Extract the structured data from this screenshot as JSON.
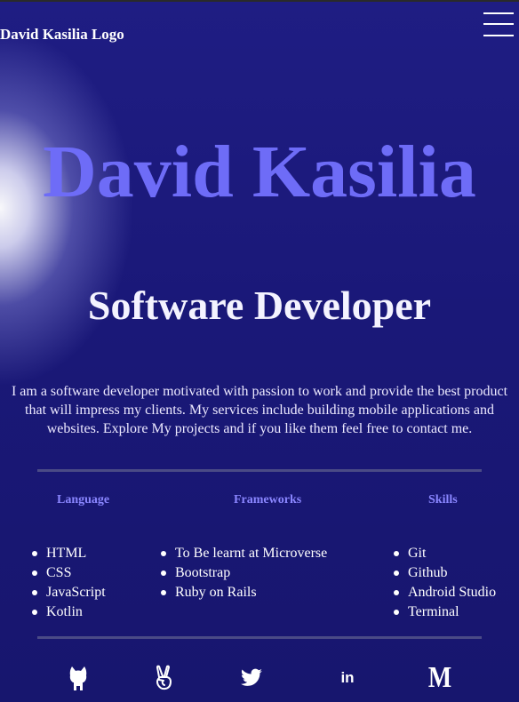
{
  "header": {
    "logo_text": "David Kasilia Logo",
    "menu_icon": "hamburger-menu-icon"
  },
  "hero": {
    "name": "David Kasilia",
    "role": "Software Developer",
    "intro": "I am a software developer motivated with passion to work and provide the best product that will impress my clients. My services include building mobile applications and websites. Explore My projects and if you like them feel free to contact me."
  },
  "columns": [
    {
      "heading": "Language",
      "items": [
        "HTML",
        "CSS",
        "JavaScript",
        "Kotlin"
      ]
    },
    {
      "heading": "Frameworks",
      "items": [
        "To Be learnt at Microverse",
        "Bootstrap",
        "Ruby on Rails"
      ]
    },
    {
      "heading": "Skills",
      "items": [
        "Git",
        "Github",
        "Android Studio",
        "Terminal"
      ]
    }
  ],
  "social": {
    "icons": [
      "github-icon",
      "angellist-icon",
      "twitter-icon",
      "linkedin-icon",
      "medium-icon"
    ],
    "linkedin_label": "in",
    "medium_label": "M"
  },
  "colors": {
    "background": "#1a1875",
    "accent": "#6e6cf7",
    "heading_accent": "#8a86ff",
    "text": "#ffffff"
  }
}
